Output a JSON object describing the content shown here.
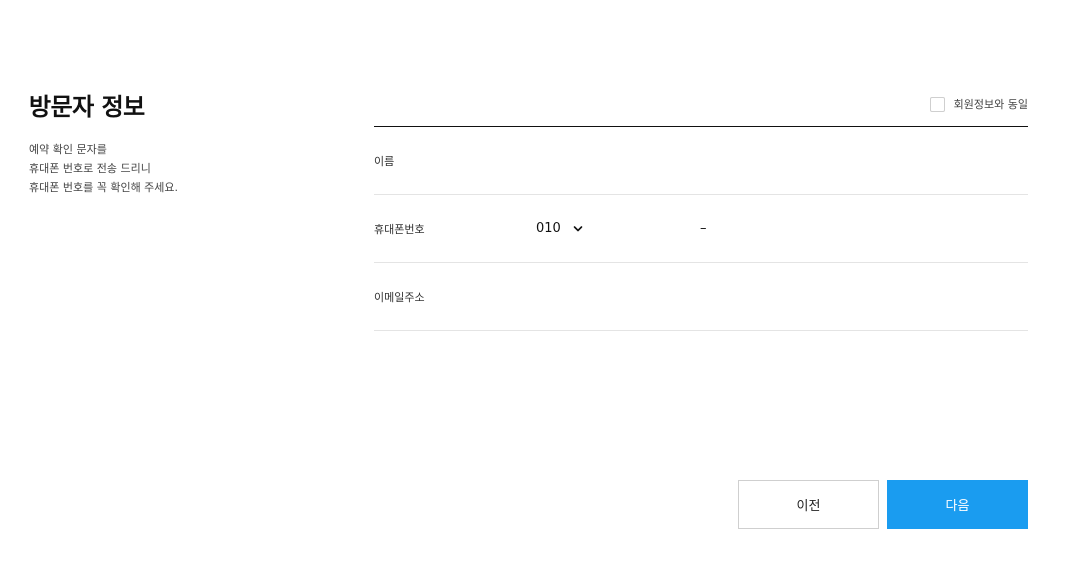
{
  "intro": {
    "title": "방문자 정보",
    "desc_lines": [
      "예약 확인 문자를",
      "휴대폰 번호로 전송 드리니",
      "휴대폰 번호를 꼭 확인해 주세요."
    ]
  },
  "form": {
    "same_as_member_label": "회원정보와 동일",
    "fields": {
      "name_label": "이름",
      "name_value": "",
      "phone_label": "휴대폰번호",
      "phone_prefix": "010",
      "phone_separator": "–",
      "phone_middle": "",
      "phone_last": "",
      "email_label": "이메일주소",
      "email_value": ""
    }
  },
  "buttons": {
    "prev_label": "이전",
    "next_label": "다음"
  },
  "colors": {
    "accent": "#1a9cf0",
    "divider_strong": "#111111",
    "divider_light": "#e4e4e4"
  },
  "icons": {
    "prefix_dropdown": "chevron-down-icon"
  }
}
